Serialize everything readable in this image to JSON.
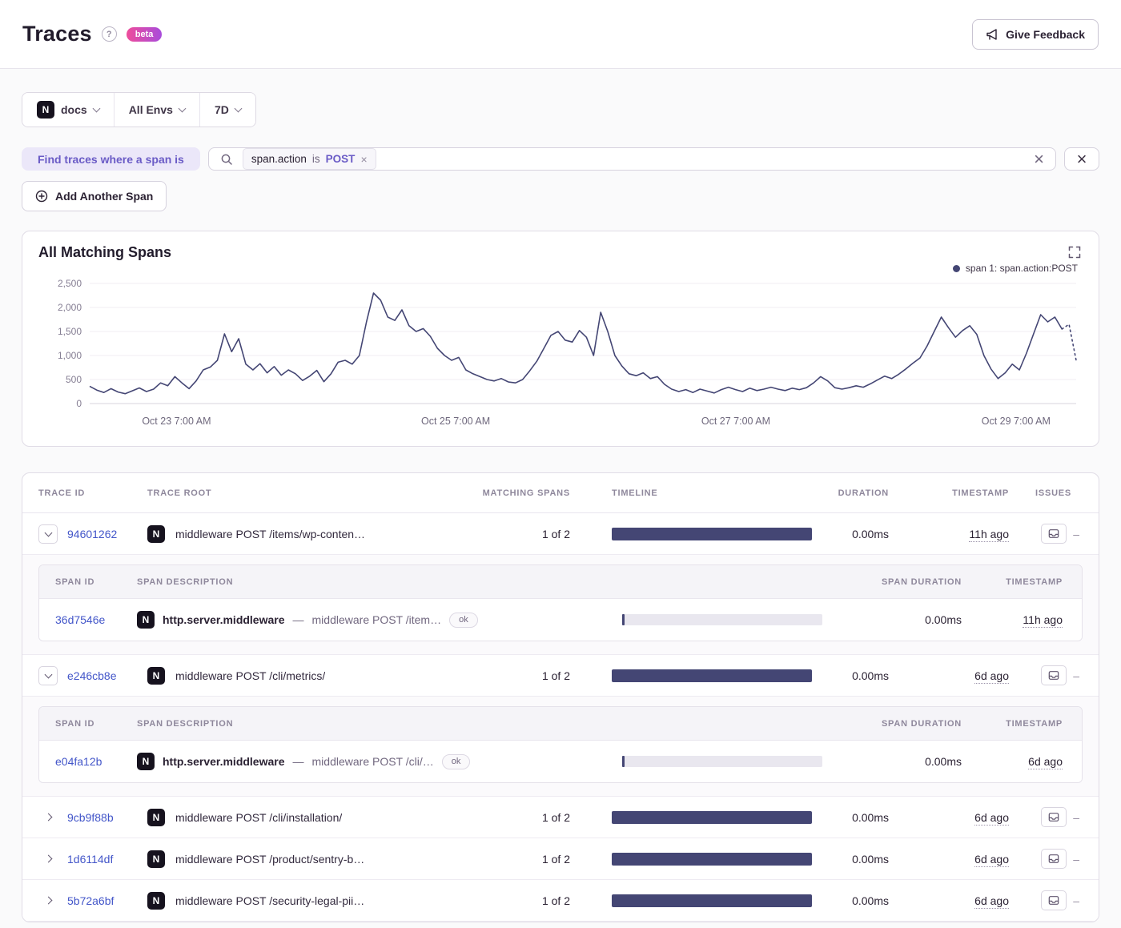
{
  "header": {
    "title": "Traces",
    "beta_label": "beta",
    "feedback_label": "Give Feedback"
  },
  "filters": {
    "project": "docs",
    "environment": "All Envs",
    "date_range": "7D"
  },
  "search": {
    "builder_label": "Find traces where a span is",
    "token_key": "span.action",
    "token_op": "is",
    "token_value": "POST",
    "token_remove": "×",
    "clear_glyph": "×",
    "close_glyph": "×"
  },
  "actions": {
    "add_span_label": "Add Another Span"
  },
  "platform": {
    "letter": "N"
  },
  "chart": {
    "title": "All Matching Spans",
    "legend_label": "span 1: span.action:POST"
  },
  "chart_data": {
    "type": "line",
    "title": "All Matching Spans",
    "legend": [
      "span 1: span.action:POST"
    ],
    "line_color": "#444674",
    "ylim": [
      0,
      2500
    ],
    "y_ticks": [
      "0",
      "500",
      "1,000",
      "1,500",
      "2,000",
      "2,500"
    ],
    "x_ticks": [
      {
        "frac": 0.088,
        "label": "Oct 23 7:00 AM"
      },
      {
        "frac": 0.371,
        "label": "Oct 25 7:00 AM"
      },
      {
        "frac": 0.655,
        "label": "Oct 27 7:00 AM"
      },
      {
        "frac": 0.939,
        "label": "Oct 29 7:00 AM"
      }
    ],
    "dashed_tail_from_index": 137,
    "series": [
      {
        "name": "span 1: span.action:POST",
        "values": [
          360,
          280,
          230,
          310,
          240,
          205,
          265,
          325,
          250,
          300,
          430,
          370,
          560,
          430,
          310,
          470,
          700,
          760,
          900,
          1450,
          1080,
          1350,
          820,
          700,
          830,
          640,
          770,
          590,
          700,
          620,
          480,
          570,
          690,
          455,
          620,
          860,
          900,
          820,
          1000,
          1700,
          2300,
          2150,
          1800,
          1730,
          1950,
          1620,
          1500,
          1560,
          1400,
          1150,
          1000,
          900,
          960,
          700,
          620,
          560,
          500,
          470,
          520,
          450,
          430,
          500,
          680,
          880,
          1150,
          1420,
          1500,
          1320,
          1280,
          1520,
          1380,
          1000,
          1900,
          1500,
          1000,
          780,
          620,
          580,
          640,
          520,
          560,
          400,
          300,
          250,
          290,
          230,
          300,
          260,
          220,
          290,
          340,
          290,
          250,
          320,
          270,
          300,
          340,
          300,
          270,
          320,
          290,
          330,
          430,
          560,
          470,
          330,
          300,
          330,
          370,
          340,
          410,
          490,
          570,
          520,
          610,
          720,
          840,
          950,
          1200,
          1500,
          1800,
          1580,
          1380,
          1520,
          1620,
          1440,
          1000,
          720,
          520,
          640,
          820,
          700,
          1050,
          1450,
          1850,
          1700,
          1800,
          1550,
          1650,
          900
        ]
      }
    ]
  },
  "table": {
    "columns": [
      "TRACE ID",
      "TRACE ROOT",
      "MATCHING SPANS",
      "TIMELINE",
      "DURATION",
      "TIMESTAMP",
      "ISSUES"
    ],
    "span_columns": [
      "SPAN ID",
      "SPAN DESCRIPTION",
      "SPAN DURATION",
      "TIMESTAMP"
    ],
    "issues_dash": "–",
    "op_separator": "—",
    "rows": [
      {
        "trace_id": "94601262",
        "root": "middleware POST /items/wp-conten…",
        "matching": "1 of 2",
        "duration": "0.00ms",
        "timestamp": "11h ago",
        "spans": [
          {
            "span_id": "36d7546e",
            "op": "http.server.middleware",
            "description": "middleware POST /item…",
            "status": "ok",
            "duration": "0.00ms",
            "timestamp": "11h ago"
          }
        ]
      },
      {
        "trace_id": "e246cb8e",
        "root": "middleware POST /cli/metrics/",
        "matching": "1 of 2",
        "duration": "0.00ms",
        "timestamp": "6d ago",
        "spans": [
          {
            "span_id": "e04fa12b",
            "op": "http.server.middleware",
            "description": "middleware POST /cli/…",
            "status": "ok",
            "duration": "0.00ms",
            "timestamp": "6d ago"
          }
        ]
      },
      {
        "trace_id": "9cb9f88b",
        "root": "middleware POST /cli/installation/",
        "matching": "1 of 2",
        "duration": "0.00ms",
        "timestamp": "6d ago"
      },
      {
        "trace_id": "1d6114df",
        "root": "middleware POST /product/sentry-b…",
        "matching": "1 of 2",
        "duration": "0.00ms",
        "timestamp": "6d ago"
      },
      {
        "trace_id": "5b72a6bf",
        "root": "middleware POST /security-legal-pii…",
        "matching": "1 of 2",
        "duration": "0.00ms",
        "timestamp": "6d ago"
      }
    ]
  },
  "colors": {
    "accent_purple": "#6a5bc6",
    "chart_line": "#444674",
    "timeline_bar": "#444674",
    "link": "#4356c9",
    "beta_gradient_start": "#ee4d9b",
    "beta_gradient_end": "#a84bdb"
  }
}
